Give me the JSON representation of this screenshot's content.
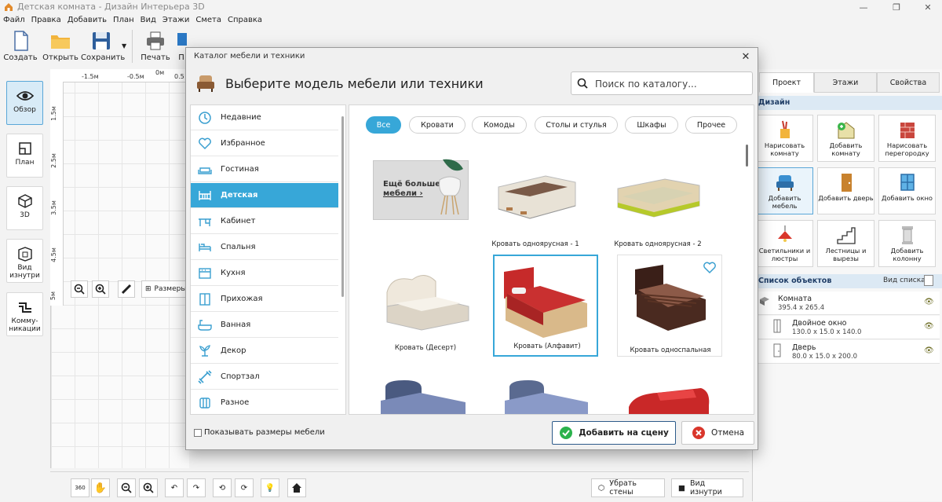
{
  "window": {
    "title": "Детская комната - Дизайн Интерьера 3D"
  },
  "menu": [
    "Файл",
    "Правка",
    "Добавить",
    "План",
    "Вид",
    "Этажи",
    "Смета",
    "Справка"
  ],
  "toolbar": [
    {
      "label": "Создать",
      "icon": "new-file-icon"
    },
    {
      "label": "Открыть",
      "icon": "folder-icon"
    },
    {
      "label": "Сохранить",
      "icon": "floppy-icon"
    },
    {
      "label": "Печать",
      "icon": "printer-icon"
    },
    {
      "label": "П",
      "icon": "monitor-icon"
    }
  ],
  "left_nav": [
    {
      "label": "Обзор",
      "icon": "eye-icon",
      "active": true
    },
    {
      "label": "План",
      "icon": "plan-icon"
    },
    {
      "label": "3D",
      "icon": "cube-icon"
    },
    {
      "label": "Вид изнутри",
      "icon": "inside-view-icon"
    },
    {
      "label": "Комму-никации",
      "icon": "pipes-icon"
    }
  ],
  "plan": {
    "ruler_top": [
      "-1.5м",
      "-0.5м",
      "0м",
      "0.5"
    ],
    "ruler_left": [
      "1.5м",
      "2.5м",
      "3.5м",
      "4.5м",
      "5м"
    ],
    "tools_label": "Размеры"
  },
  "bottom_bar": {
    "remove_walls": "Убрать стены",
    "inside_view": "Вид изнутри",
    "rotate_label": "360"
  },
  "right_panel": {
    "tabs": [
      "Проект",
      "Этажи",
      "Свойства"
    ],
    "design_title": "Дизайн",
    "design_tiles": [
      {
        "label": "Нарисовать комнату",
        "icon": "paint-brushes-icon"
      },
      {
        "label": "Добавить комнату",
        "icon": "add-room-icon"
      },
      {
        "label": "Нарисовать перегородку",
        "icon": "brick-wall-icon"
      },
      {
        "label": "Добавить мебель",
        "icon": "armchair-icon",
        "active": true
      },
      {
        "label": "Добавить дверь",
        "icon": "door-icon"
      },
      {
        "label": "Добавить окно",
        "icon": "window-icon"
      },
      {
        "label": "Светильники и люстры",
        "icon": "lamp-icon"
      },
      {
        "label": "Лестницы и вырезы",
        "icon": "stairs-icon"
      },
      {
        "label": "Добавить колонну",
        "icon": "column-icon"
      }
    ],
    "objects_title": "Список объектов",
    "view_list": "Вид списка",
    "objects": [
      {
        "name": "Комната",
        "dims": "395.4 x 265.4",
        "icon": "room-icon"
      },
      {
        "name": "Двойное окно",
        "dims": "130.0 x 15.0 x 140.0",
        "icon": "window-icon"
      },
      {
        "name": "Дверь",
        "dims": "80.0 x 15.0 x 200.0",
        "icon": "door-icon"
      }
    ]
  },
  "dialog": {
    "title": "Каталог мебели и техники",
    "heading": "Выберите модель мебели или техники",
    "search_placeholder": "Поиск по каталогу...",
    "categories": [
      {
        "label": "Недавние",
        "icon": "clock-icon"
      },
      {
        "label": "Избранное",
        "icon": "heart-icon"
      },
      {
        "label": "Гостиная",
        "icon": "sofa-icon"
      },
      {
        "label": "Детская",
        "icon": "crib-icon",
        "active": true
      },
      {
        "label": "Кабинет",
        "icon": "desk-icon"
      },
      {
        "label": "Спальня",
        "icon": "bed-icon"
      },
      {
        "label": "Кухня",
        "icon": "stove-icon"
      },
      {
        "label": "Прихожая",
        "icon": "wardrobe-icon"
      },
      {
        "label": "Ванная",
        "icon": "bathtub-icon"
      },
      {
        "label": "Декор",
        "icon": "plant-icon"
      },
      {
        "label": "Спортзал",
        "icon": "dumbbell-icon"
      },
      {
        "label": "Разное",
        "icon": "misc-icon"
      }
    ],
    "filters": [
      {
        "label": "Все",
        "active": true
      },
      {
        "label": "Кровати"
      },
      {
        "label": "Комоды"
      },
      {
        "label": "Столы и стулья"
      },
      {
        "label": "Шкафы"
      },
      {
        "label": "Прочее"
      }
    ],
    "promo": {
      "line1": "Ещё больше",
      "line2": "мебели ›"
    },
    "items": [
      {
        "caption": "Кровать одноярусная - 1"
      },
      {
        "caption": "Кровать одноярусная - 2"
      },
      {
        "caption": "Кровать (Десерт)"
      },
      {
        "caption": "Кровать (Алфавит)",
        "selected": true
      },
      {
        "caption": "Кровать односпальная"
      }
    ],
    "show_sizes": "Показывать размеры мебели",
    "add_button": "Добавить на сцену",
    "cancel_button": "Отмена"
  },
  "colors": {
    "accent": "#37a7d8",
    "section": "#dce9f4",
    "ok_green": "#2bb24c",
    "cancel_red": "#d9362b"
  }
}
